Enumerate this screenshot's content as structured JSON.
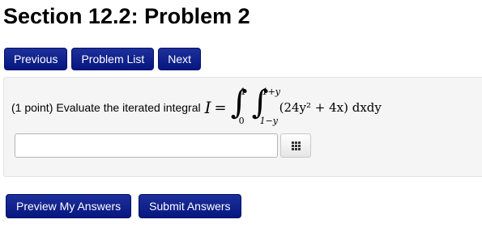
{
  "page": {
    "title": "Section 12.2: Problem 2"
  },
  "nav": {
    "previous_label": "Previous",
    "problem_list_label": "Problem List",
    "next_label": "Next"
  },
  "problem": {
    "points": "(1 point)",
    "statement": "Evaluate the iterated integral",
    "math": {
      "variable": "I",
      "equals": "=",
      "integral_sign": "∫",
      "outer_upper": "1",
      "outer_lower": "0",
      "inner_upper": "1+y",
      "inner_lower": "1−y",
      "integrand": "(24y² + 4x) dxdy"
    }
  },
  "answer": {
    "value": "",
    "placeholder": "",
    "palette_icon": "grid-icon"
  },
  "actions": {
    "preview_label": "Preview My Answers",
    "submit_label": "Submit Answers"
  },
  "colors": {
    "button_bg": "#0a1f86",
    "button_text": "#ffffff",
    "panel_bg": "#f5f5f5"
  }
}
